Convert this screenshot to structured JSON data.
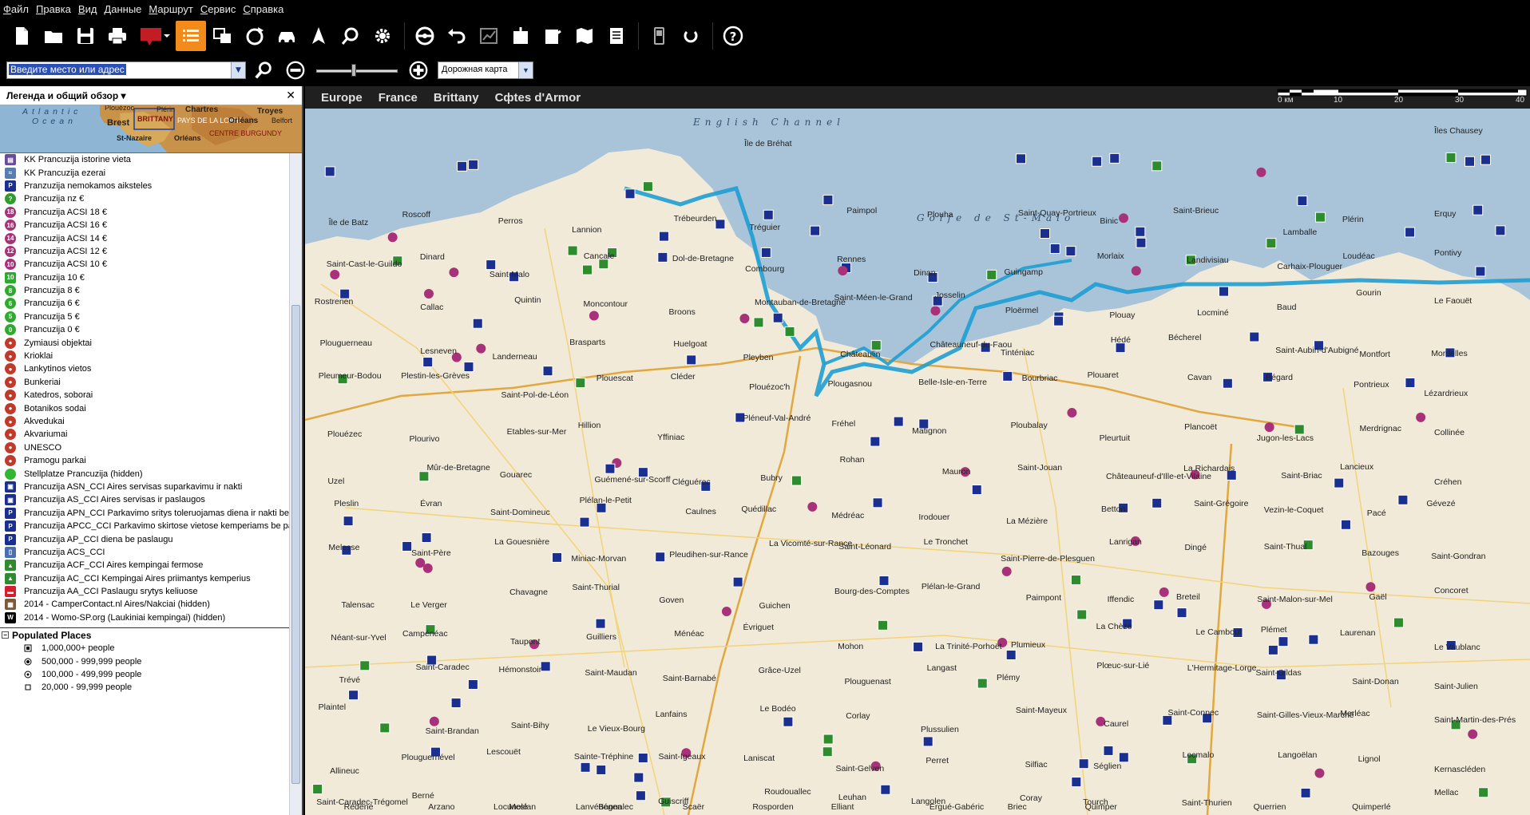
{
  "menu": [
    "Файл",
    "Правка",
    "Вид",
    "Данные",
    "Маршрут",
    "Сервис",
    "Справка"
  ],
  "search": {
    "placeholder": "Введите место или адрес",
    "selected_text": "Введите место или адрес"
  },
  "map_type": "Дорожная карта",
  "panel": {
    "title": "Легенда и общий обзор ▾",
    "close": "✕"
  },
  "overview": [
    "Atlantic",
    "Ocean",
    "Brest",
    "BRITTANY",
    "PAYS DE LA LOIRE",
    "CENTRE BURGUNDY",
    "Chartres",
    "Troyes",
    "Orléans",
    "Belfort",
    "St-Nazaire",
    "Orléans",
    "Plouézoc",
    "Plérin"
  ],
  "legend": [
    {
      "label": "KK Prancuzija istorine vieta",
      "icon": "monument-icon",
      "color": "#6a4a9c",
      "shape": "square",
      "glyph": "▤"
    },
    {
      "label": "KK Prancuzija ezerai",
      "icon": "lake-icon",
      "color": "#5a7db0",
      "shape": "square",
      "glyph": "≈"
    },
    {
      "label": "Pranzuzija nemokamos aiksteles",
      "icon": "parking-icon",
      "color": "#1a2f8f",
      "shape": "square",
      "glyph": "P"
    },
    {
      "label": "Prancuzija nz €",
      "icon": "question-icon",
      "color": "#2e9d2e",
      "shape": "circle",
      "glyph": "?"
    },
    {
      "label": "Prancuzija ACSI 18 €",
      "icon": "acsi-18-icon",
      "color": "#a8327a",
      "shape": "circle",
      "glyph": "18"
    },
    {
      "label": "Prancuzija ACSI 16 €",
      "icon": "acsi-16-icon",
      "color": "#a8327a",
      "shape": "circle",
      "glyph": "16"
    },
    {
      "label": "Prancuzija ACSI 14 €",
      "icon": "acsi-14-icon",
      "color": "#a8327a",
      "shape": "circle",
      "glyph": "14"
    },
    {
      "label": "Prancuzija ACSI 12 €",
      "icon": "acsi-12-icon",
      "color": "#a8327a",
      "shape": "circle",
      "glyph": "12"
    },
    {
      "label": "Prancuzija ACSI 10 €",
      "icon": "acsi-10-icon",
      "color": "#a8327a",
      "shape": "circle",
      "glyph": "10"
    },
    {
      "label": "Prancuzija 10 €",
      "icon": "price-10-icon",
      "color": "#2eaa2e",
      "shape": "square",
      "glyph": "10"
    },
    {
      "label": "Prancuzija 8 €",
      "icon": "price-8-icon",
      "color": "#2eaa2e",
      "shape": "circle",
      "glyph": "8"
    },
    {
      "label": "Prancuzija 6 €",
      "icon": "price-6-icon",
      "color": "#2eaa2e",
      "shape": "circle",
      "glyph": "6"
    },
    {
      "label": "Prancuzija 5 €",
      "icon": "price-5-icon",
      "color": "#2eaa2e",
      "shape": "circle",
      "glyph": "5"
    },
    {
      "label": "Prancuzija 0 €",
      "icon": "price-0-icon",
      "color": "#2eaa2e",
      "shape": "circle",
      "glyph": "0"
    },
    {
      "label": "Zymiausi objektai",
      "icon": "landmark-icon",
      "color": "#c0392b",
      "shape": "circle",
      "glyph": "●"
    },
    {
      "label": "Krioklai",
      "icon": "waterfall-icon",
      "color": "#c0392b",
      "shape": "circle",
      "glyph": "●"
    },
    {
      "label": "Lankytinos vietos",
      "icon": "sight-icon",
      "color": "#c0392b",
      "shape": "circle",
      "glyph": "●"
    },
    {
      "label": "Bunkeriai",
      "icon": "bunker-icon",
      "color": "#c0392b",
      "shape": "circle",
      "glyph": "●"
    },
    {
      "label": "Katedros, soborai",
      "icon": "cathedral-icon",
      "color": "#c0392b",
      "shape": "circle",
      "glyph": "●"
    },
    {
      "label": "Botanikos sodai",
      "icon": "garden-icon",
      "color": "#c0392b",
      "shape": "circle",
      "glyph": "●"
    },
    {
      "label": "Akvedukai",
      "icon": "aqueduct-icon",
      "color": "#c0392b",
      "shape": "circle",
      "glyph": "●"
    },
    {
      "label": "Akvariumai",
      "icon": "aquarium-icon",
      "color": "#c0392b",
      "shape": "circle",
      "glyph": "●"
    },
    {
      "label": "UNESCO",
      "icon": "unesco-icon",
      "color": "#c0392b",
      "shape": "circle",
      "glyph": "●"
    },
    {
      "label": "Pramogu parkai",
      "icon": "amusement-park-icon",
      "color": "#c0392b",
      "shape": "circle",
      "glyph": "●"
    },
    {
      "label": "Stellplatze Prancuzija (hidden)",
      "icon": "green-dot-icon",
      "color": "#33b533",
      "shape": "circle",
      "glyph": ""
    },
    {
      "label": "Prancuzija ASN_CCI Aires servisas suparkavimu ir nakti",
      "icon": "asn-icon",
      "color": "#1a2f8f",
      "shape": "square",
      "glyph": "▣"
    },
    {
      "label": "Prancuzija AS_CCI Aires servisas ir paslaugos",
      "icon": "as-icon",
      "color": "#1a2f8f",
      "shape": "square",
      "glyph": "▣"
    },
    {
      "label": "Prancuzija APN_CCI Parkavimo sritys toleruojamas diena ir nakti be paslaugu",
      "icon": "apn-icon",
      "color": "#1a2f8f",
      "shape": "square",
      "glyph": "P"
    },
    {
      "label": "Prancuzija APCC_CCI Parkavimo skirtose vietose kemperiams be paslaugu",
      "icon": "apcc-icon",
      "color": "#1a2f8f",
      "shape": "square",
      "glyph": "P"
    },
    {
      "label": "Prancuzija AP_CCI diena be paslaugu",
      "icon": "ap-icon",
      "color": "#1a2f8f",
      "shape": "square",
      "glyph": "P"
    },
    {
      "label": "Prancuzija ACS_CCI",
      "icon": "acs-icon",
      "color": "#4a6fb0",
      "shape": "square",
      "glyph": "▯"
    },
    {
      "label": "Prancuzija ACF_CCI Aires kempingai fermose",
      "icon": "acf-icon",
      "color": "#2e8b2e",
      "shape": "square",
      "glyph": "▲"
    },
    {
      "label": "Prancuzija AC_CCI Kempingai Aires priimantys kemperius",
      "icon": "ac-icon",
      "color": "#2e8b2e",
      "shape": "square",
      "glyph": "▲"
    },
    {
      "label": "Prancuzija AA_CCI Paslaugu srytys keliuose",
      "icon": "aa-icon",
      "color": "#d21f2b",
      "shape": "square",
      "glyph": "▬"
    },
    {
      "label": "2014 - CamperContact.nl Aires/Nakciai (hidden)",
      "icon": "campercontact-icon",
      "color": "#7a5a3a",
      "shape": "square",
      "glyph": "▦"
    },
    {
      "label": "2014 - Womo-SP.org (Laukiniai kempingai) (hidden)",
      "icon": "womo-icon",
      "color": "#000000",
      "shape": "square",
      "glyph": "W"
    }
  ],
  "populated": {
    "header": "Populated Places",
    "items": [
      {
        "label": "1,000,000+ people",
        "icon": "pop-1m-icon"
      },
      {
        "label": "500,000 - 999,999 people",
        "icon": "pop-500k-icon"
      },
      {
        "label": "100,000 - 499,999 people",
        "icon": "pop-100k-icon"
      },
      {
        "label": "20,000 - 99,999 people",
        "icon": "pop-20k-icon"
      }
    ]
  },
  "breadcrumbs": [
    "Europe",
    "France",
    "Brittany",
    "Cфtes d'Armor"
  ],
  "scale": {
    "labels": [
      "0 км",
      "10",
      "20",
      "30",
      "40"
    ]
  },
  "map": {
    "seas": [
      "English Channel",
      "Golfe de St-Malo"
    ],
    "places": [
      "Île de Bréhat",
      "Îles Chausey",
      "Île de Batz",
      "Roscoff",
      "Perros",
      "Lannion",
      "Trébeurden",
      "Tréguier",
      "Paimpol",
      "Plouha",
      "Saint-Quay-Portrieux",
      "Binic",
      "Saint-Brieuc",
      "Lamballe",
      "Plérin",
      "Erquy",
      "Saint-Cast-le-Guildo",
      "Dinard",
      "Saint-Malo",
      "Cancale",
      "Dol-de-Bretagne",
      "Combourg",
      "Rennes",
      "Dinan",
      "Guingamp",
      "Morlaix",
      "Landivisiau",
      "Carhaix-Plouguer",
      "Loudéac",
      "Pontivy",
      "Rostrenen",
      "Callac",
      "Quintin",
      "Moncontour",
      "Broons",
      "Montauban-de-Bretagne",
      "Saint-Méen-le-Grand",
      "Josselin",
      "Ploërmel",
      "Plouay",
      "Locminé",
      "Baud",
      "Gourin",
      "Le Faouët",
      "Plouguerneau",
      "Lesneven",
      "Landerneau",
      "Brasparts",
      "Huelgoat",
      "Pleyben",
      "Châteaulin",
      "Châteauneuf-du-Faou",
      "Tinténiac",
      "Hédé",
      "Bécherel",
      "Saint-Aubin-d'Aubigné",
      "Montfort",
      "Mordelles",
      "Pleumeur-Bodou",
      "Plestin-les-Grèves",
      "Saint-Pol-de-Léon",
      "Plouescat",
      "Cléder",
      "Plouézoc'h",
      "Plougasnou",
      "Belle-Isle-en-Terre",
      "Bourbriac",
      "Plouaret",
      "Cavan",
      "Bégard",
      "Pontrieux",
      "Lézardrieux",
      "Plouézec",
      "Plourivo",
      "Etables-sur-Mer",
      "Hillion",
      "Yffiniac",
      "Pléneuf-Val-André",
      "Fréhel",
      "Matignon",
      "Ploubalay",
      "Pleurtuit",
      "Plancoët",
      "Jugon-les-Lacs",
      "Merdrignac",
      "Collinée",
      "Uzel",
      "Mûr-de-Bretagne",
      "Gouarec",
      "Guémené-sur-Scorff",
      "Cléguérec",
      "Bubry",
      "Rohan",
      "Mauron",
      "Saint-Jouan",
      "Châteauneuf-d'Ille-et-Vilaine",
      "La Richardais",
      "Saint-Briac",
      "Lancieux",
      "Créhen",
      "Pleslin",
      "Évran",
      "Saint-Domineuc",
      "Plélan-le-Petit",
      "Caulnes",
      "Quédillac",
      "Médréac",
      "Irodouer",
      "La Mézière",
      "Betton",
      "Saint-Grégoire",
      "Vezin-le-Coquet",
      "Pacé",
      "Gévezé",
      "Melesse",
      "Saint-Père",
      "La Gouesnière",
      "Miniac-Morvan",
      "Pleudihen-sur-Rance",
      "La Vicomté-sur-Rance",
      "Saint-Léonard",
      "Le Tronchet",
      "Saint-Pierre-de-Plesguen",
      "Lanrigan",
      "Dingé",
      "Saint-Thual",
      "Bazouges",
      "Saint-Gondran",
      "Talensac",
      "Le Verger",
      "Chavagne",
      "Saint-Thurial",
      "Goven",
      "Guichen",
      "Bourg-des-Comptes",
      "Plélan-le-Grand",
      "Paimpont",
      "Iffendic",
      "Breteil",
      "Saint-Malon-sur-Mel",
      "Gaël",
      "Concoret",
      "Néant-sur-Yvel",
      "Campénéac",
      "Taupont",
      "Guilliers",
      "Ménéac",
      "Évriguet",
      "Mohon",
      "La Trinité-Porhoët",
      "Plumieux",
      "La Chèze",
      "Le Cambout",
      "Plémet",
      "Laurenan",
      "Le Vaublanc",
      "Trévé",
      "Saint-Caradec",
      "Hémonstoir",
      "Saint-Maudan",
      "Saint-Barnabé",
      "Grâce-Uzel",
      "Plouguenast",
      "Langast",
      "Plémy",
      "Plœuc-sur-Lié",
      "L'Hermitage-Lorge",
      "Saint-Gildas",
      "Saint-Donan",
      "Saint-Julien",
      "Plaintel",
      "Saint-Brandan",
      "Saint-Bihy",
      "Le Vieux-Bourg",
      "Lanfains",
      "Le Bodéo",
      "Corlay",
      "Plussulien",
      "Saint-Mayeux",
      "Caurel",
      "Saint-Connec",
      "Saint-Gilles-Vieux-Marché",
      "Merléac",
      "Saint-Martin-des-Prés",
      "Allineuc",
      "Plouguernével",
      "Lescouët",
      "Sainte-Tréphine",
      "Saint-Igeaux",
      "Laniscat",
      "Saint-Gelven",
      "Perret",
      "Silfiac",
      "Séglien",
      "Locmalo",
      "Langoëlan",
      "Lignol",
      "Kernascléden",
      "Saint-Caradec-Trégomel",
      "Berné",
      "Meslan",
      "Lanvénégen",
      "Guiscriff",
      "Roudouallec",
      "Leuhan",
      "Langolen",
      "Coray",
      "Tourch",
      "Saint-Thurien",
      "Querrien",
      "Quimperlé",
      "Mellac",
      "Rédéné",
      "Arzano",
      "Locunolé",
      "Bannalec",
      "Scaër",
      "Rosporden",
      "Elliant",
      "Ergué-Gabéric",
      "Briec",
      "Quimper"
    ]
  }
}
